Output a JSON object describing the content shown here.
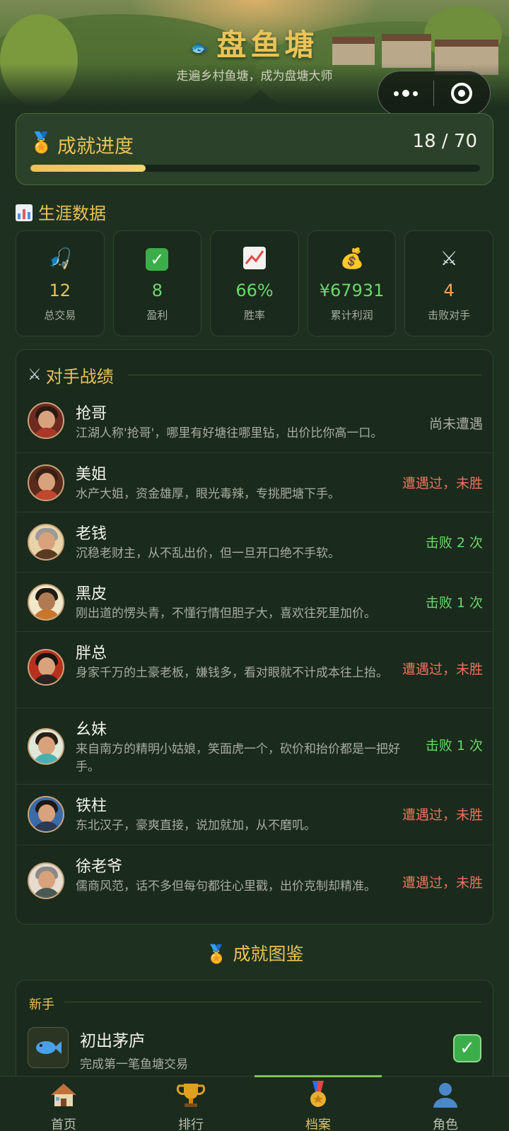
{
  "header": {
    "title": "盘鱼塘",
    "subtitle": "走遍乡村鱼塘，成为盘塘大师"
  },
  "progress": {
    "title": "成就进度",
    "count": "18 / 70",
    "fraction": 0.257
  },
  "career": {
    "title": "生涯数据",
    "stats": [
      {
        "value": "12",
        "label": "总交易",
        "icon": "fishing-icon",
        "color": "#e6c15a"
      },
      {
        "value": "8",
        "label": "盈利",
        "icon": "check-icon",
        "color": "#6cd86c"
      },
      {
        "value": "66%",
        "label": "胜率",
        "icon": "trend-icon",
        "color": "#6cd86c"
      },
      {
        "value": "¥67931",
        "label": "累计利润",
        "icon": "money-bag-icon",
        "color": "#6cd86c"
      },
      {
        "value": "4",
        "label": "击败对手",
        "icon": "swords-icon",
        "color": "#f3a45a"
      }
    ]
  },
  "opponents": {
    "title": "对手战绩",
    "items": [
      {
        "name": "抢哥",
        "desc": "江湖人称'抢哥'，哪里有好塘往哪里钻，出价比你高一口。",
        "status": "尚未遭遇",
        "status_color": "#a8ada2"
      },
      {
        "name": "美姐",
        "desc": "水产大姐，资金雄厚，眼光毒辣，专挑肥塘下手。",
        "status": "遭遇过，未胜",
        "status_color": "#e8745a"
      },
      {
        "name": "老钱",
        "desc": "沉稳老财主，从不乱出价，但一旦开口绝不手软。",
        "status": "击败 2 次",
        "status_color": "#6cd86c"
      },
      {
        "name": "黑皮",
        "desc": "刚出道的愣头青，不懂行情但胆子大，喜欢往死里加价。",
        "status": "击败 1 次",
        "status_color": "#6cd86c"
      },
      {
        "name": "胖总",
        "desc": "身家千万的土豪老板，嫌钱多，看对眼就不计成本往上抬。",
        "status": "遭遇过，未胜",
        "status_color": "#e8745a"
      },
      {
        "name": "幺妹",
        "desc": "来自南方的精明小姑娘，笑面虎一个，砍价和抬价都是一把好手。",
        "status": "击败 1 次",
        "status_color": "#6cd86c"
      },
      {
        "name": "铁柱",
        "desc": "东北汉子，豪爽直接，说加就加，从不磨叽。",
        "status": "遭遇过，未胜",
        "status_color": "#e8745a"
      },
      {
        "name": "徐老爷",
        "desc": "儒商风范，话不多但每句都往心里戳，出价克制却精准。",
        "status": "遭遇过，未胜",
        "status_color": "#e8745a"
      }
    ]
  },
  "achievements": {
    "title": "成就图鉴",
    "category": "新手",
    "first": {
      "name": "初出茅庐",
      "desc": "完成第一笔鱼塘交易",
      "done": true
    }
  },
  "tabs": [
    {
      "label": "首页",
      "icon": "home-icon"
    },
    {
      "label": "排行",
      "icon": "trophy-icon"
    },
    {
      "label": "档案",
      "icon": "medal-icon",
      "active": true
    },
    {
      "label": "角色",
      "icon": "user-icon"
    }
  ]
}
